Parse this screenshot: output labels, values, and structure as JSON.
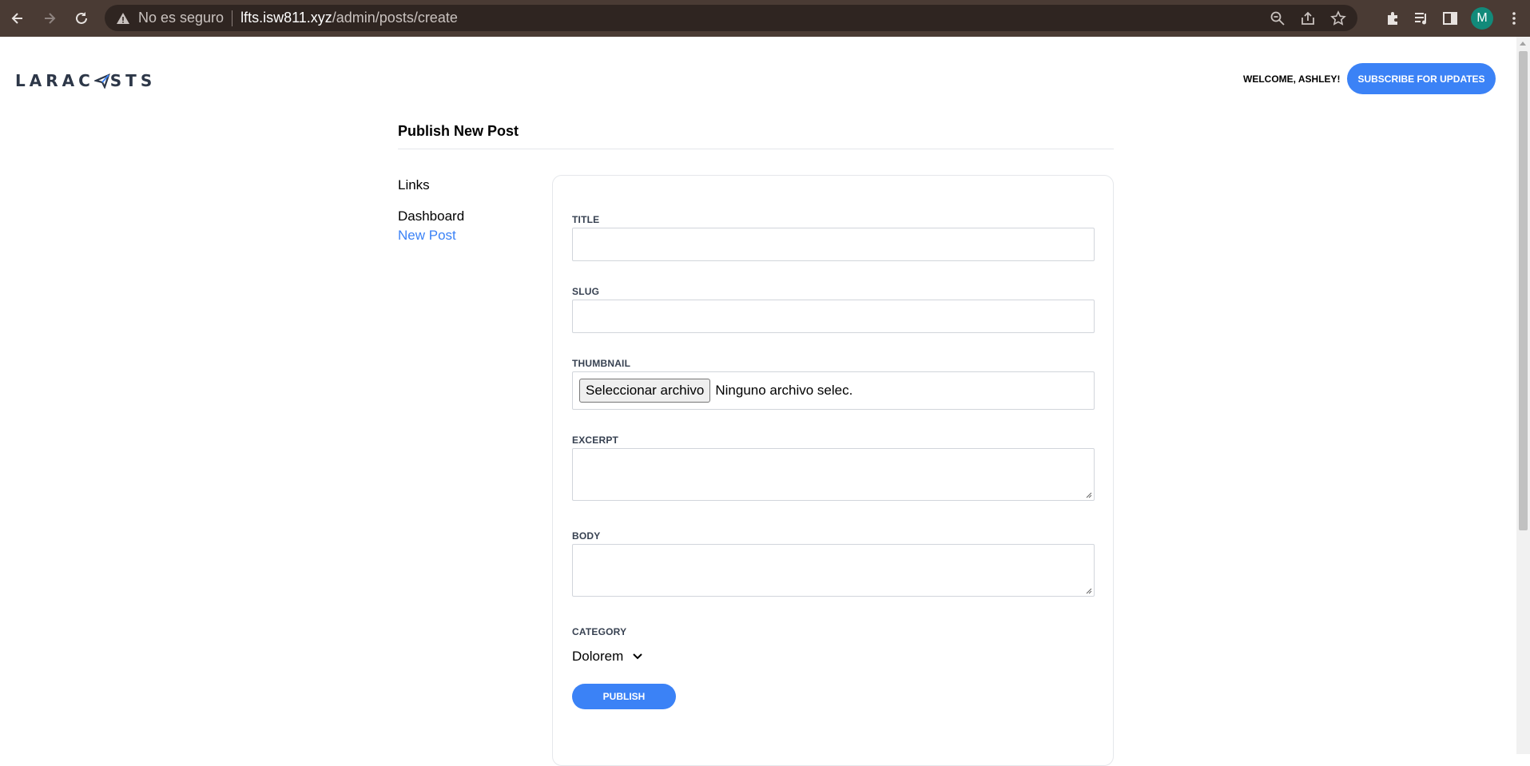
{
  "browser": {
    "insecure_label": "No es seguro",
    "url_host": "lfts.isw811.xyz",
    "url_path": "/admin/posts/create",
    "profile_initial": "M"
  },
  "header": {
    "logo_text_left": "LARAC",
    "logo_text_right": "STS",
    "welcome": "WELCOME, ASHLEY!",
    "subscribe_label": "SUBSCRIBE FOR UPDATES"
  },
  "page": {
    "title": "Publish New Post"
  },
  "sidebar": {
    "title": "Links",
    "items": [
      {
        "label": "Dashboard",
        "active": false
      },
      {
        "label": "New Post",
        "active": true
      }
    ]
  },
  "form": {
    "title_label": "TITLE",
    "title_value": "",
    "slug_label": "SLUG",
    "slug_value": "",
    "thumbnail_label": "THUMBNAIL",
    "file_button": "Seleccionar archivo",
    "file_status": "Ninguno archivo selec.",
    "excerpt_label": "EXCERPT",
    "excerpt_value": "",
    "body_label": "BODY",
    "body_value": "",
    "category_label": "CATEGORY",
    "category_value": "Dolorem",
    "publish_label": "PUBLISH"
  },
  "colors": {
    "accent": "#3b82f6",
    "chrome": "#4a3b34",
    "omnibox": "#2f2521",
    "avatar": "#128a7a"
  }
}
